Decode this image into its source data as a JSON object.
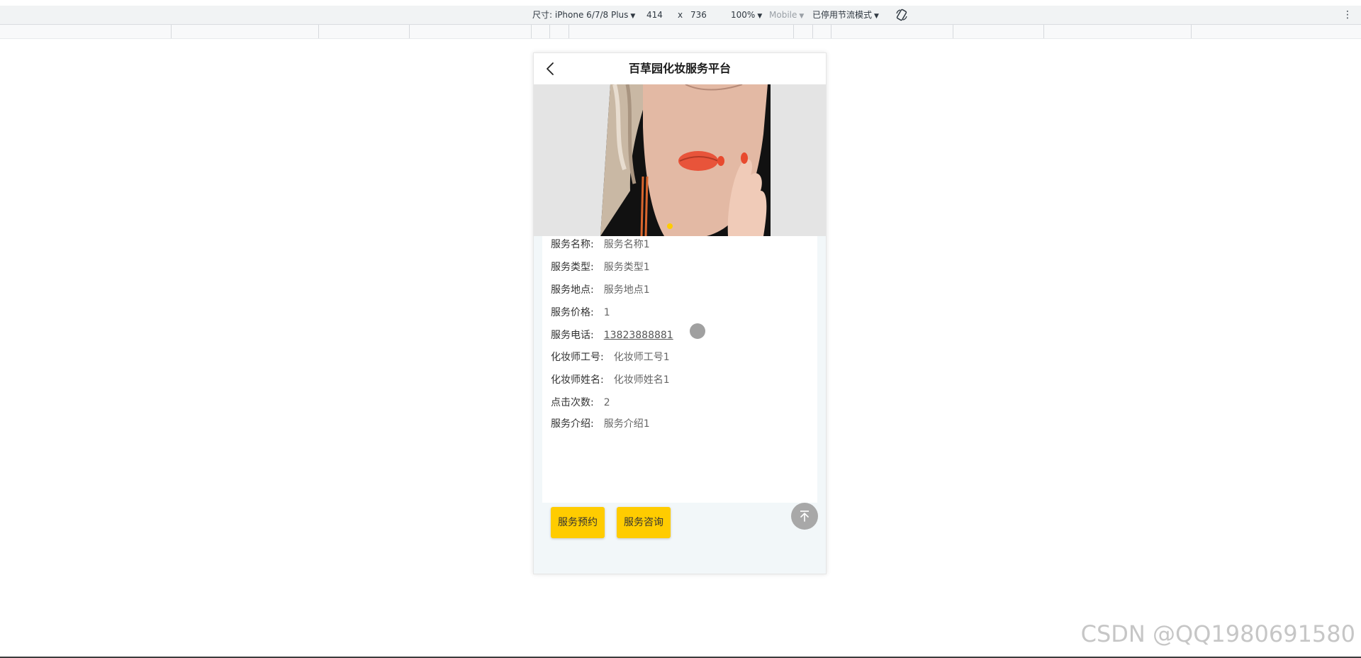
{
  "devtools": {
    "size_label": "尺寸: iPhone 6/7/8 Plus",
    "width": "414",
    "times": "x",
    "height": "736",
    "zoom": "100%",
    "mode": "Mobile",
    "throttle": "已停用节流模式",
    "more": "⋮"
  },
  "app": {
    "title": "百草园化妆服务平台",
    "fields": [
      {
        "label": "服务名称:",
        "value": "服务名称1"
      },
      {
        "label": "服务类型:",
        "value": "服务类型1"
      },
      {
        "label": "服务地点:",
        "value": "服务地点1"
      },
      {
        "label": "服务价格:",
        "value": "1"
      },
      {
        "label": "服务电话:",
        "value": "13823888881"
      },
      {
        "label": "化妆师工号:",
        "value": "化妆师工号1"
      },
      {
        "label": "化妆师姓名:",
        "value": "化妆师姓名1"
      },
      {
        "label": "点击次数:",
        "value": "2"
      },
      {
        "label": "服务介绍:",
        "value": "服务介绍1"
      }
    ],
    "buttons": {
      "book": "服务预约",
      "consult": "服务咨询"
    }
  },
  "colors": {
    "accent": "#ffcc00",
    "page_bg": "#f2f7f9"
  },
  "watermark": "CSDN @QQ1980691580"
}
